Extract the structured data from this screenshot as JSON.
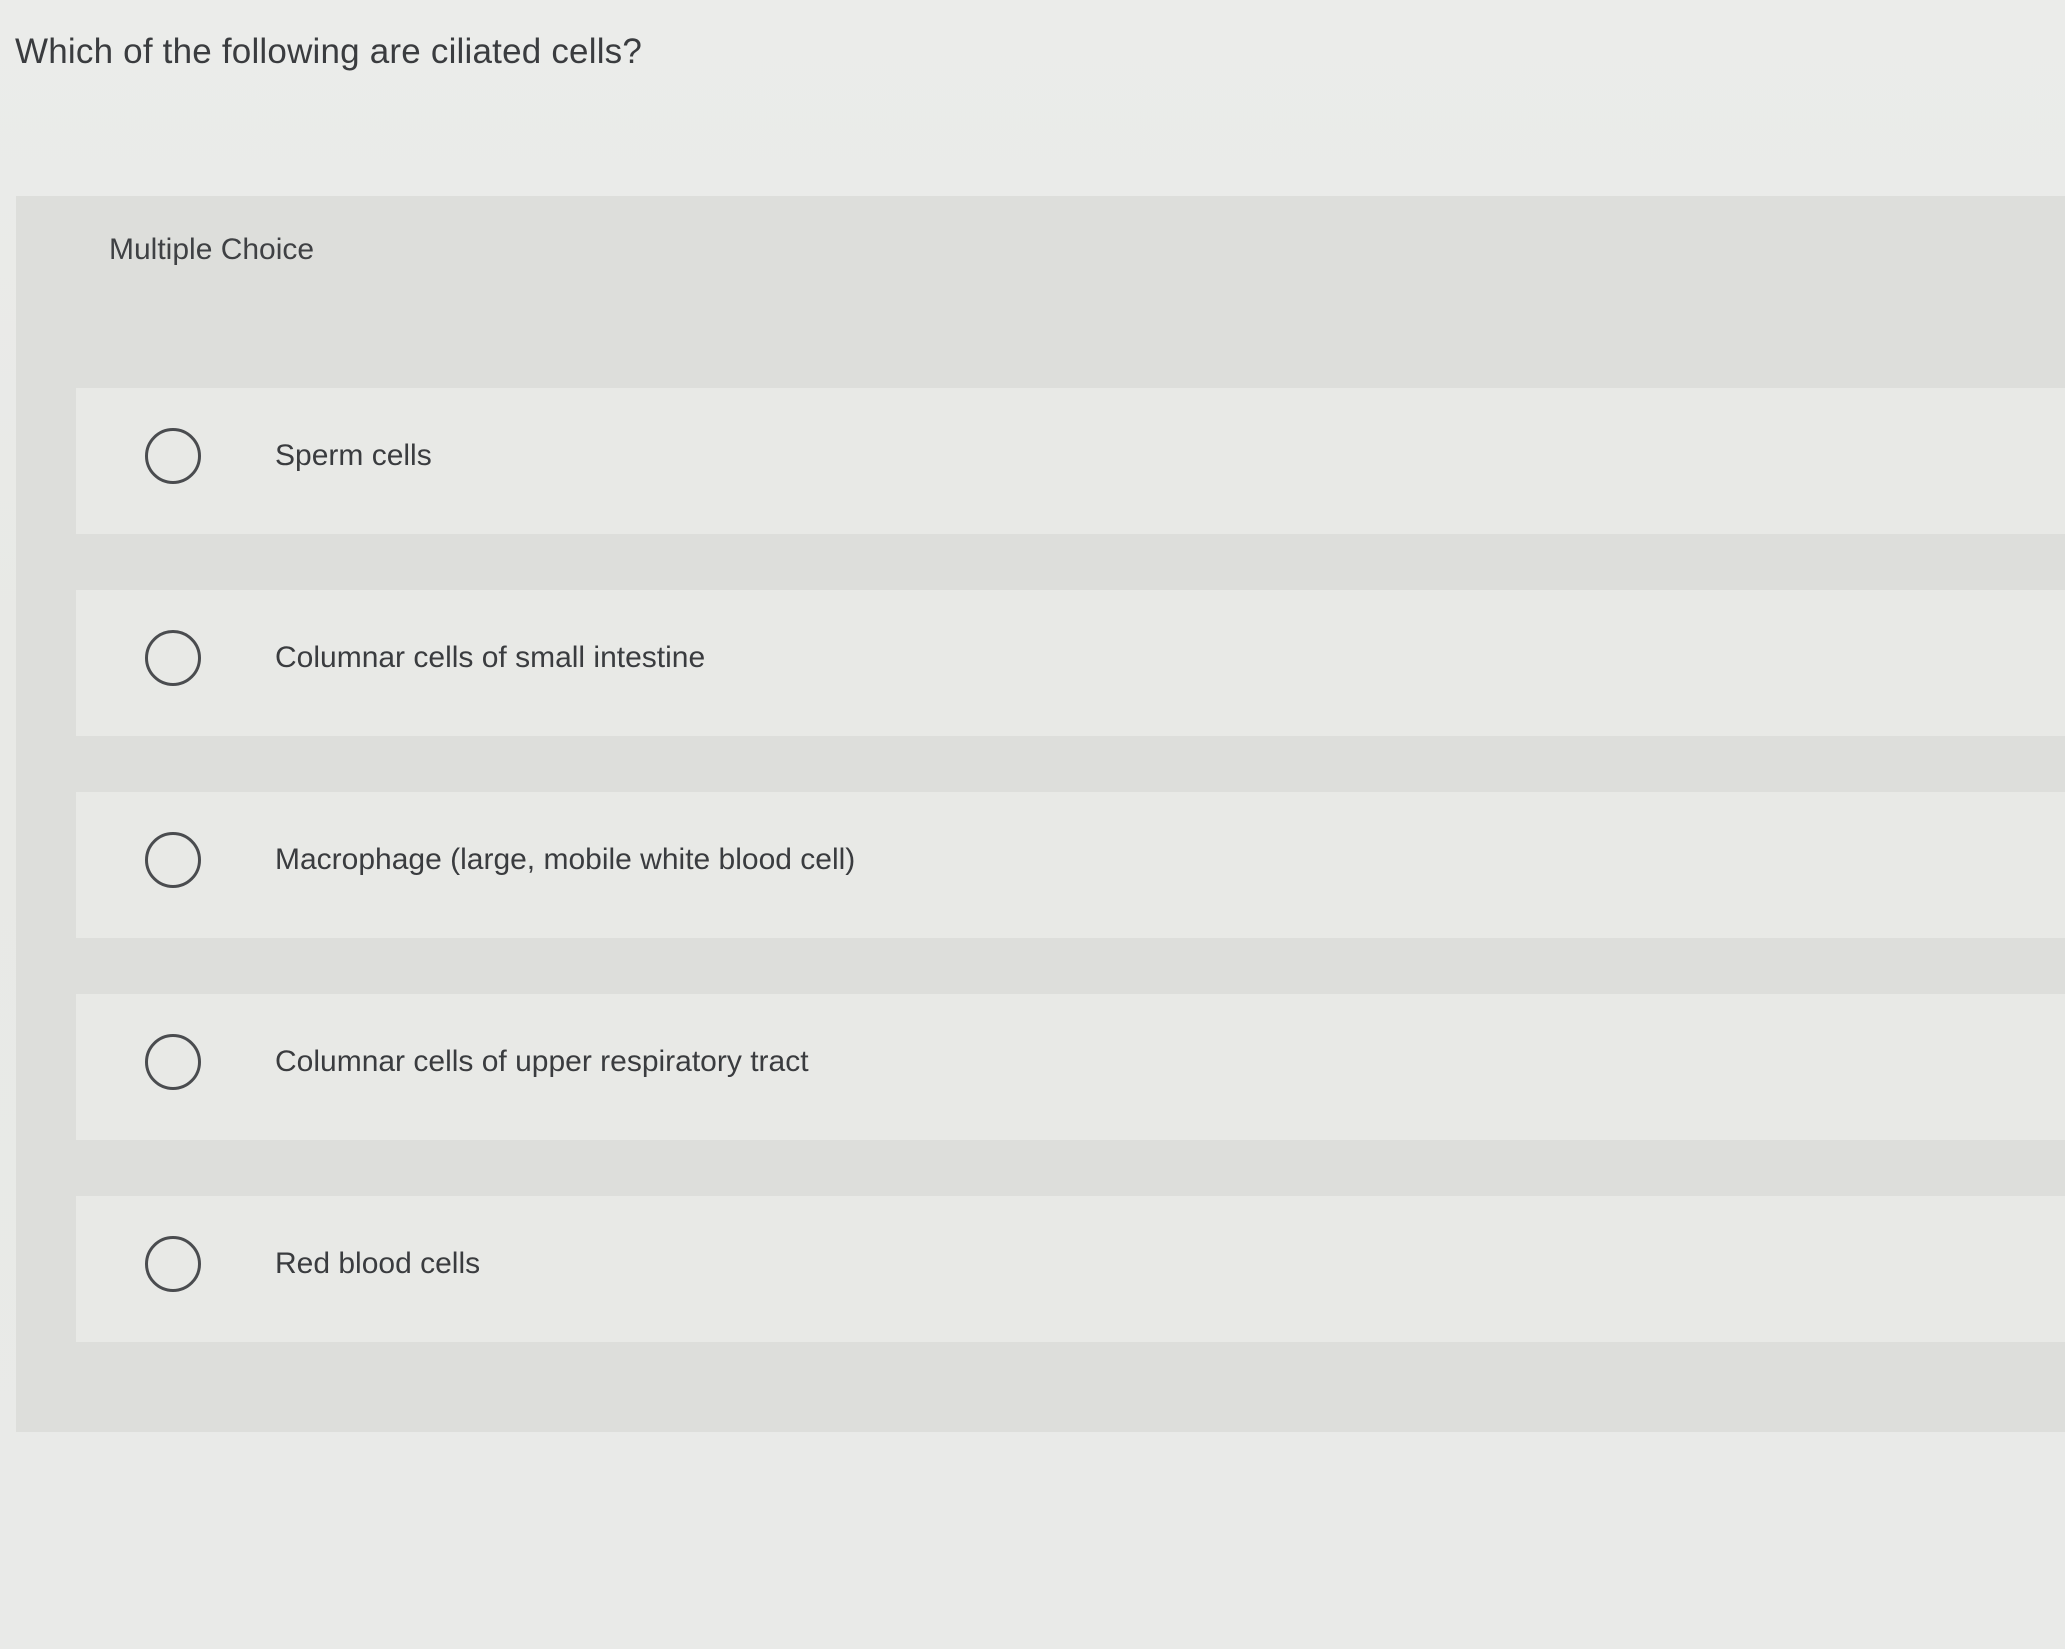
{
  "question": {
    "text": "Which of the following are ciliated cells?"
  },
  "choice_panel": {
    "type_label": "Multiple Choice",
    "options": [
      {
        "label": "Sperm cells"
      },
      {
        "label": "Columnar cells of small intestine"
      },
      {
        "label": "Macrophage (large, mobile white blood cell)"
      },
      {
        "label": "Columnar cells of upper respiratory tract"
      },
      {
        "label": "Red blood cells"
      }
    ]
  }
}
